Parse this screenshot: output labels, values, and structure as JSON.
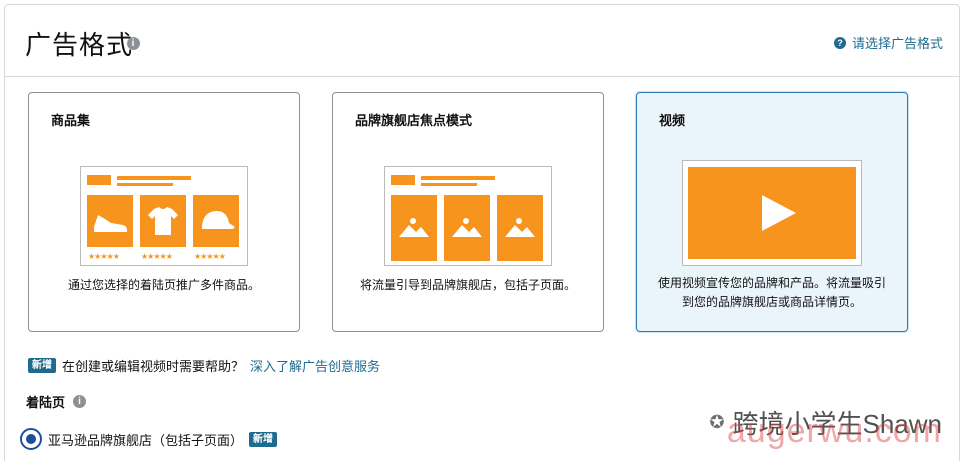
{
  "header": {
    "title": "广告格式",
    "help_link": "请选择广告格式"
  },
  "cards": [
    {
      "title": "商品集",
      "description": "通过您选择的着陆页推广多件商品。",
      "icons": [
        "shoe-icon",
        "tshirt-icon",
        "cap-icon"
      ],
      "stars": "★★★★★"
    },
    {
      "title": "品牌旗舰店焦点模式",
      "description": "将流量引导到品牌旗舰店，包括子页面。",
      "icons": [
        "image-icon",
        "image-icon",
        "image-icon"
      ]
    },
    {
      "title": "视频",
      "description_line1": "使用视频宣传您的品牌和产品。将流量吸引",
      "description_line2": "到您的品牌旗舰店或商品详情页。",
      "icons": [
        "play-icon"
      ],
      "selected": true
    }
  ],
  "help_row": {
    "badge": "新增",
    "text": "在创建或编辑视频时需要帮助？",
    "link": "深入了解广告创意服务"
  },
  "landing": {
    "label": "着陆页",
    "option": "亚马逊品牌旗舰店（包括子页面）",
    "option_badge": "新增"
  },
  "watermark": {
    "line1": "跨境小学生Shawn",
    "line2": "augerwu.com"
  },
  "colors": {
    "accent": "#f7941d",
    "link": "#1f6b8f",
    "selected_border": "#2e7bb5"
  }
}
